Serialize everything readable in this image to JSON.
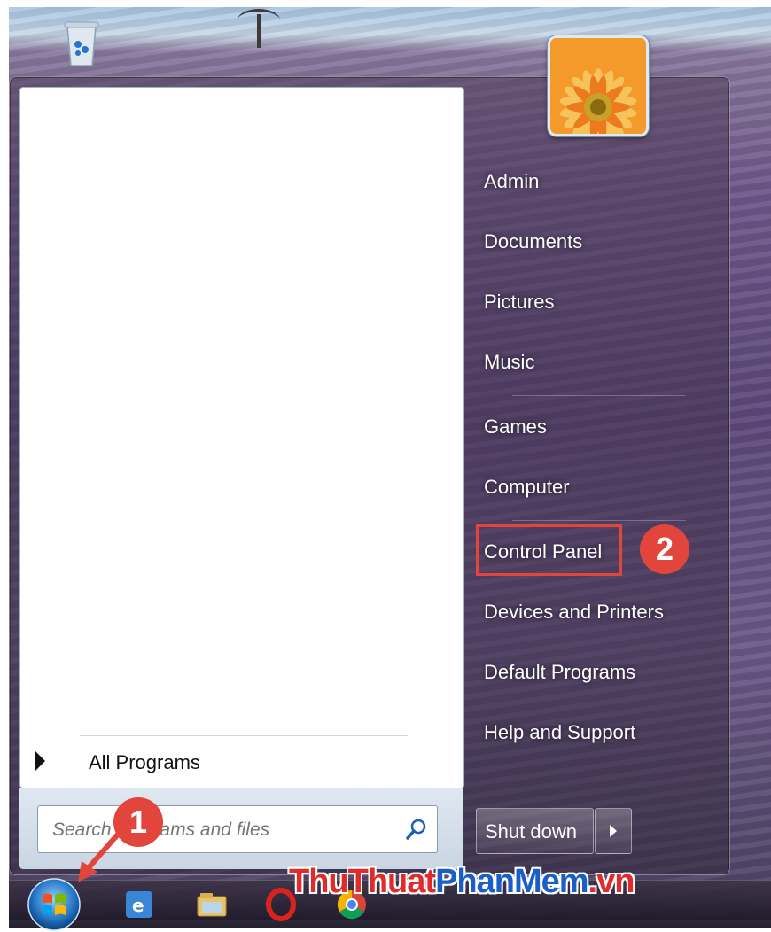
{
  "start_menu": {
    "left": {
      "all_programs_label": "All Programs",
      "search": {
        "placeholder": "Search programs and files",
        "value": ""
      }
    },
    "right": {
      "items": [
        {
          "label": "Admin"
        },
        {
          "label": "Documents"
        },
        {
          "label": "Pictures"
        },
        {
          "label": "Music"
        },
        {
          "label": "Games"
        },
        {
          "label": "Computer"
        },
        {
          "label": "Control Panel"
        },
        {
          "label": "Devices and Printers"
        },
        {
          "label": "Default Programs"
        },
        {
          "label": "Help and Support"
        }
      ],
      "shutdown_label": "Shut down"
    }
  },
  "annotations": {
    "step1": "1",
    "step2": "2",
    "highlight_color": "#e2453b"
  },
  "watermark": {
    "part1": "ThuThuat",
    "part2": "PhanMem",
    "part3": ".vn"
  },
  "icons": [
    "recycle-bin-icon",
    "user-picture-icon",
    "search-icon",
    "start-orb-icon",
    "ie-icon",
    "explorer-icon",
    "opera-icon",
    "chrome-icon"
  ]
}
